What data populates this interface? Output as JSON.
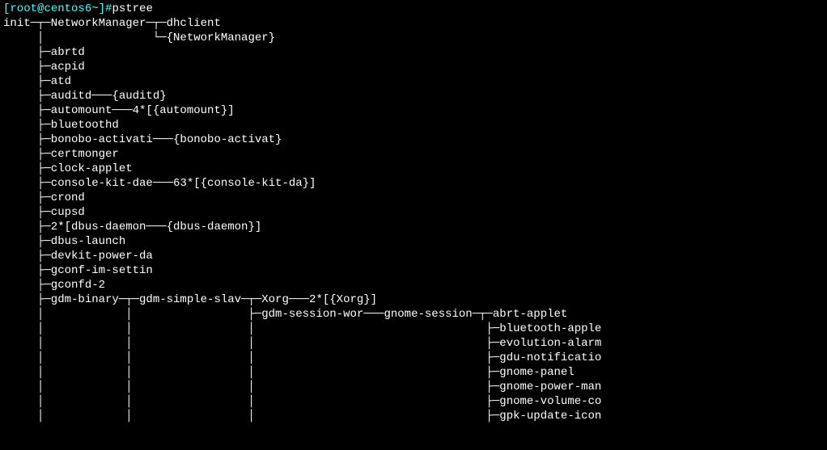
{
  "prompt": {
    "open_bracket": "[",
    "user": "root",
    "at": "@",
    "host": "centos6",
    "tilde": "~",
    "close_bracket": "]",
    "hash": "#"
  },
  "command": "pstree",
  "tree": {
    "l01": "init─┬─NetworkManager─┬─dhclient",
    "l02": "     │                └─{NetworkManager}",
    "l03": "     ├─abrtd",
    "l04": "     ├─acpid",
    "l05": "     ├─atd",
    "l06": "     ├─auditd───{auditd}",
    "l07": "     ├─automount───4*[{automount}]",
    "l08": "     ├─bluetoothd",
    "l09": "     ├─bonobo-activati───{bonobo-activat}",
    "l10": "     ├─certmonger",
    "l11": "     ├─clock-applet",
    "l12": "     ├─console-kit-dae───63*[{console-kit-da}]",
    "l13": "     ├─crond",
    "l14": "     ├─cupsd",
    "l15": "     ├─2*[dbus-daemon───{dbus-daemon}]",
    "l16": "     ├─dbus-launch",
    "l17": "     ├─devkit-power-da",
    "l18": "     ├─gconf-im-settin",
    "l19": "     ├─gconfd-2",
    "l20": "     ├─gdm-binary─┬─gdm-simple-slav─┬─Xorg───2*[{Xorg}]",
    "l21": "     │            │                 ├─gdm-session-wor───gnome-session─┬─abrt-applet",
    "l22": "     │            │                 │                                  ├─bluetooth-apple",
    "l23": "     │            │                 │                                  ├─evolution-alarm",
    "l24": "     │            │                 │                                  ├─gdu-notificatio",
    "l25": "     │            │                 │                                  ├─gnome-panel",
    "l26": "     │            │                 │                                  ├─gnome-power-man",
    "l27": "     │            │                 │                                  ├─gnome-volume-co",
    "l28": "     │            │                 │                                  ├─gpk-update-icon"
  }
}
